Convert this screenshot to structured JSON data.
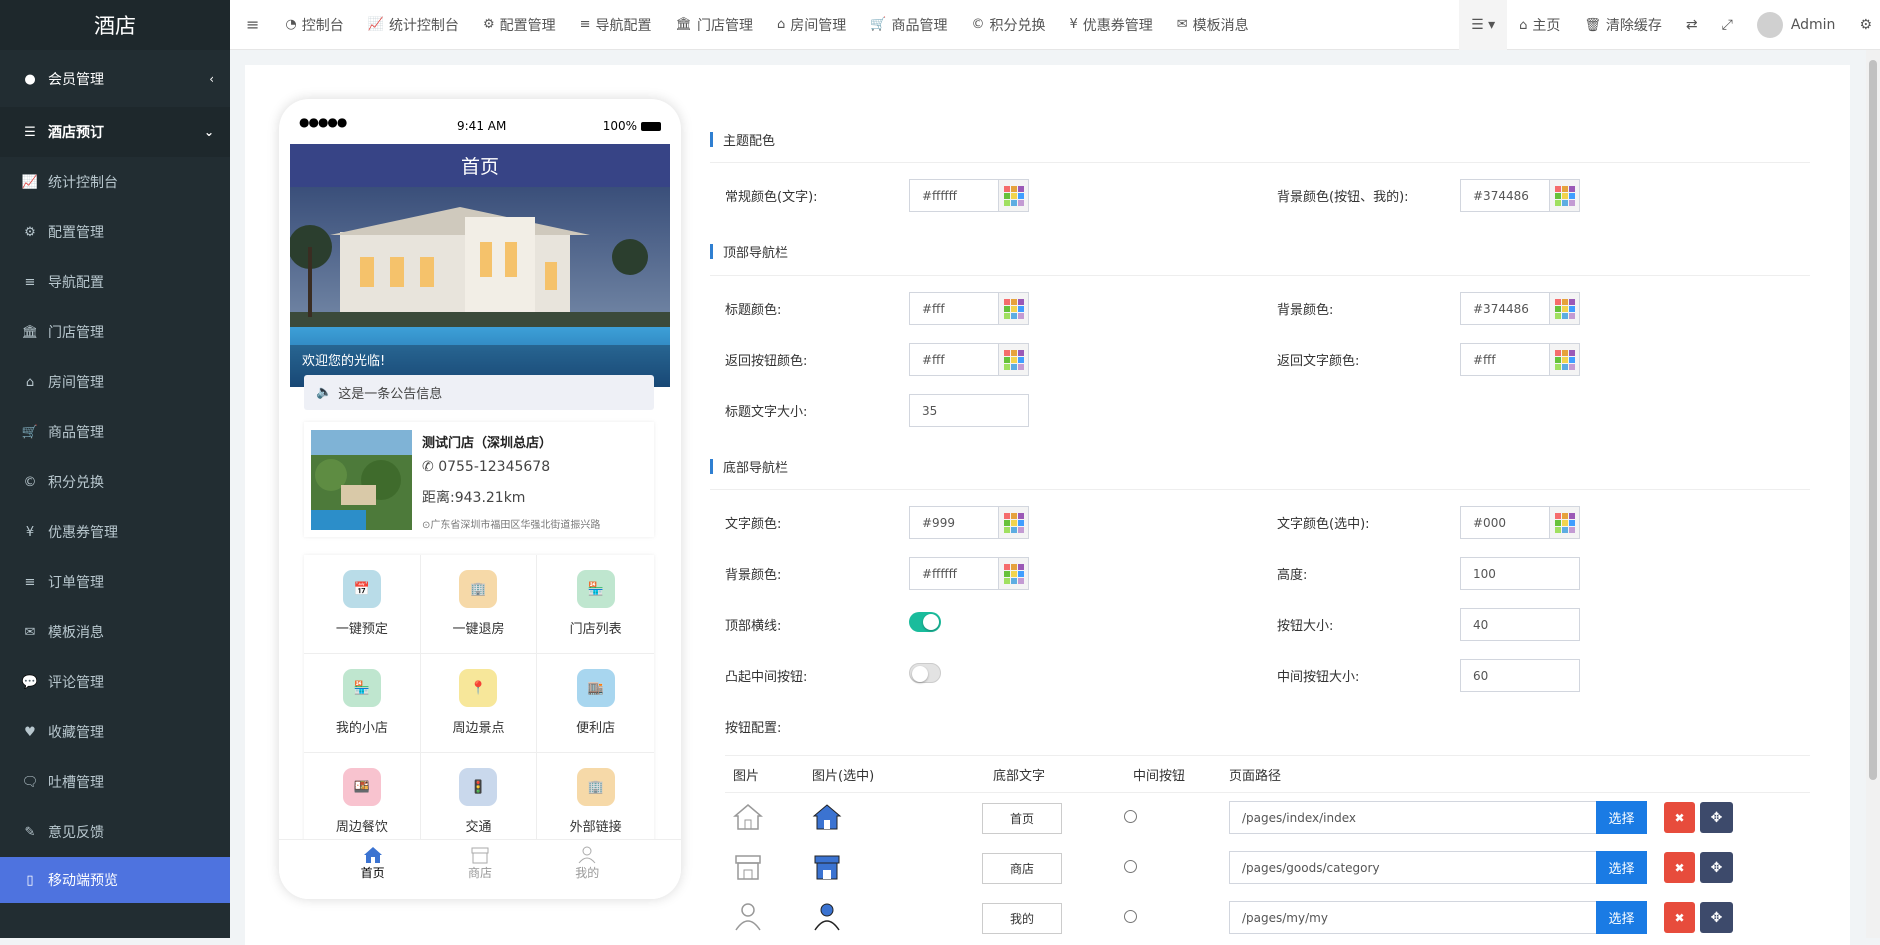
{
  "sidebar": {
    "logo": "酒店",
    "items": [
      {
        "label": "会员管理",
        "icon": "user-circle-icon"
      },
      {
        "label": "酒店预订",
        "icon": "list-icon"
      },
      {
        "label": "统计控制台",
        "icon": "area-chart-icon"
      },
      {
        "label": "配置管理",
        "icon": "gear-icon"
      },
      {
        "label": "导航配置",
        "icon": "bars-icon"
      },
      {
        "label": "门店管理",
        "icon": "bank-icon"
      },
      {
        "label": "房间管理",
        "icon": "home-icon"
      },
      {
        "label": "商品管理",
        "icon": "cart-icon"
      },
      {
        "label": "积分兑换",
        "icon": "copyright-icon"
      },
      {
        "label": "优惠券管理",
        "icon": "yen-icon"
      },
      {
        "label": "订单管理",
        "icon": "bars-icon"
      },
      {
        "label": "模板消息",
        "icon": "envelope-icon"
      },
      {
        "label": "评论管理",
        "icon": "comments-icon"
      },
      {
        "label": "收藏管理",
        "icon": "heart-icon"
      },
      {
        "label": "吐槽管理",
        "icon": "comment-icon"
      },
      {
        "label": "意见反馈",
        "icon": "pencil-icon"
      },
      {
        "label": "移动端预览",
        "icon": "mobile-icon"
      }
    ]
  },
  "topnav": {
    "items": [
      {
        "label": "控制台",
        "icon": "dashboard-icon"
      },
      {
        "label": "统计控制台",
        "icon": "area-chart-icon"
      },
      {
        "label": "配置管理",
        "icon": "gear-icon"
      },
      {
        "label": "导航配置",
        "icon": "bars-icon"
      },
      {
        "label": "门店管理",
        "icon": "bank-icon"
      },
      {
        "label": "房间管理",
        "icon": "home-icon"
      },
      {
        "label": "商品管理",
        "icon": "cart-icon"
      },
      {
        "label": "积分兑换",
        "icon": "copyright-icon"
      },
      {
        "label": "优惠券管理",
        "icon": "yen-icon"
      },
      {
        "label": "模板消息",
        "icon": "envelope-icon"
      }
    ],
    "home": "主页",
    "clear_cache": "清除缓存",
    "user": "Admin"
  },
  "phone": {
    "status_time": "9:41 AM",
    "battery": "100%",
    "title": "首页",
    "welcome": "欢迎您的光临!",
    "notice": "这是一条公告信息",
    "store": {
      "name": "测试门店（深圳总店）",
      "phone": "0755-12345678",
      "distance": "距离:943.21km",
      "address": "广东省深圳市福田区华强北街道振兴路"
    },
    "grid": [
      {
        "label": "一键预定",
        "color": "#b9dce8",
        "icon": "calendar-icon"
      },
      {
        "label": "一键退房",
        "color": "#f6d9a8",
        "icon": "checkout-icon"
      },
      {
        "label": "门店列表",
        "color": "#bfe6cf",
        "icon": "store-icon"
      },
      {
        "label": "我的小店",
        "color": "#bfe6cf",
        "icon": "shop-icon"
      },
      {
        "label": "周边景点",
        "color": "#f7e79a",
        "icon": "location-icon"
      },
      {
        "label": "便利店",
        "color": "#a8d6ef",
        "icon": "convenience-store-icon"
      },
      {
        "label": "周边餐饮",
        "color": "#f8c3cf",
        "icon": "food-icon"
      },
      {
        "label": "交通",
        "color": "#c9d8ec",
        "icon": "traffic-light-icon"
      },
      {
        "label": "外部链接",
        "color": "#f6d9a8",
        "icon": "link-icon"
      }
    ],
    "tabs": [
      {
        "label": "首页",
        "icon": "home-tab-icon"
      },
      {
        "label": "商店",
        "icon": "shop-tab-icon"
      },
      {
        "label": "我的",
        "icon": "user-tab-icon"
      }
    ]
  },
  "form": {
    "theme_section": "主题配色",
    "text_color_label": "常规颜色(文字):",
    "text_color": "#ffffff",
    "bg_color_label": "背景颜色(按钮、我的):",
    "bg_color": "#374486",
    "topnav_section": "顶部导航栏",
    "title_color_label": "标题颜色:",
    "title_color": "#fff",
    "top_bg_label": "背景颜色:",
    "top_bg": "#374486",
    "back_btn_label": "返回按钮颜色:",
    "back_btn": "#fff",
    "back_text_label": "返回文字颜色:",
    "back_text": "#fff",
    "title_size_label": "标题文字大小:",
    "title_size": "35",
    "bottomnav_section": "底部导航栏",
    "b_text_label": "文字颜色:",
    "b_text": "#999",
    "b_text_sel_label": "文字颜色(选中):",
    "b_text_sel": "#000",
    "b_bg_label": "背景颜色:",
    "b_bg": "#ffffff",
    "height_label": "高度:",
    "height": "100",
    "top_line_label": "顶部横线:",
    "top_line_on": true,
    "btn_size_label": "按钮大小:",
    "btn_size": "40",
    "raised_label": "凸起中间按钮:",
    "raised_on": false,
    "mid_size_label": "中间按钮大小:",
    "mid_size": "60",
    "btn_config_label": "按钮配置:",
    "table_headers": [
      "图片",
      "图片(选中)",
      "底部文字",
      "中间按钮",
      "页面路径"
    ],
    "rows": [
      {
        "text": "首页",
        "path": "/pages/index/index"
      },
      {
        "text": "商店",
        "path": "/pages/goods/category"
      },
      {
        "text": "我的",
        "path": "/pages/my/my"
      }
    ],
    "select_label": "选择"
  }
}
